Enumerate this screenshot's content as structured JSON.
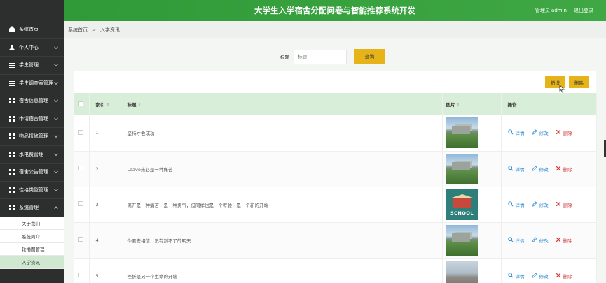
{
  "header": {
    "title": "大学生入学宿舍分配问卷与智能推荐系统开发",
    "user": "管理员 admin",
    "logout": "退出登录"
  },
  "sidebar": {
    "items": [
      {
        "label": "系统首页",
        "icon": "home-icon"
      },
      {
        "label": "个人中心",
        "icon": "user-icon"
      },
      {
        "label": "学生管理",
        "icon": "sliders-icon"
      },
      {
        "label": "学生调查表管理",
        "icon": "sliders-icon"
      },
      {
        "label": "宿舍信息管理",
        "icon": "grid-icon"
      },
      {
        "label": "申请宿舍管理",
        "icon": "grid-icon"
      },
      {
        "label": "物品报修管理",
        "icon": "grid-icon"
      },
      {
        "label": "水电费管理",
        "icon": "grid-icon"
      },
      {
        "label": "宿舍公告管理",
        "icon": "grid-icon"
      },
      {
        "label": "性格类型管理",
        "icon": "grid-icon"
      },
      {
        "label": "系统管理",
        "icon": "grid-icon"
      }
    ],
    "submenu": [
      "关于我们",
      "系统简介",
      "轮播图管理",
      "入学资讯"
    ]
  },
  "breadcrumb": {
    "home": "系统首页",
    "separator": ">",
    "current": "入学资讯"
  },
  "search": {
    "label": "标题",
    "placeholder": "标题",
    "button": "查询"
  },
  "actions": {
    "add": "新增",
    "delete": "删除"
  },
  "table": {
    "headers": {
      "index": "索引",
      "title": "标题",
      "image": "图片",
      "ops": "操作"
    },
    "sort_symbol": "⇕",
    "ops": {
      "detail": "详情",
      "edit": "修改",
      "delete": "删除"
    },
    "rows": [
      {
        "index": "1",
        "title": "坚持才会成功",
        "image": "campus"
      },
      {
        "index": "2",
        "title": "Leave未必是一种痛苦",
        "image": "campus"
      },
      {
        "index": "3",
        "title": "离开是一种痛苦，是一种勇气，但同样也是一个考验，是一个新的开端",
        "image": "school",
        "image_text": "SCHOOL"
      },
      {
        "index": "4",
        "title": "你要去相信，没有到不了的明天",
        "image": "campus"
      },
      {
        "index": "5",
        "title": "挫折是另一个生命的开端",
        "image": "tower"
      }
    ]
  },
  "colors": {
    "header": "#3fa845",
    "sidebar": "#2d2f2e",
    "button": "#e6b319",
    "table_header": "#d9eed8",
    "active_sub": "#cfe8cf",
    "link": "#2a8bd6",
    "danger": "#d43a3a"
  }
}
